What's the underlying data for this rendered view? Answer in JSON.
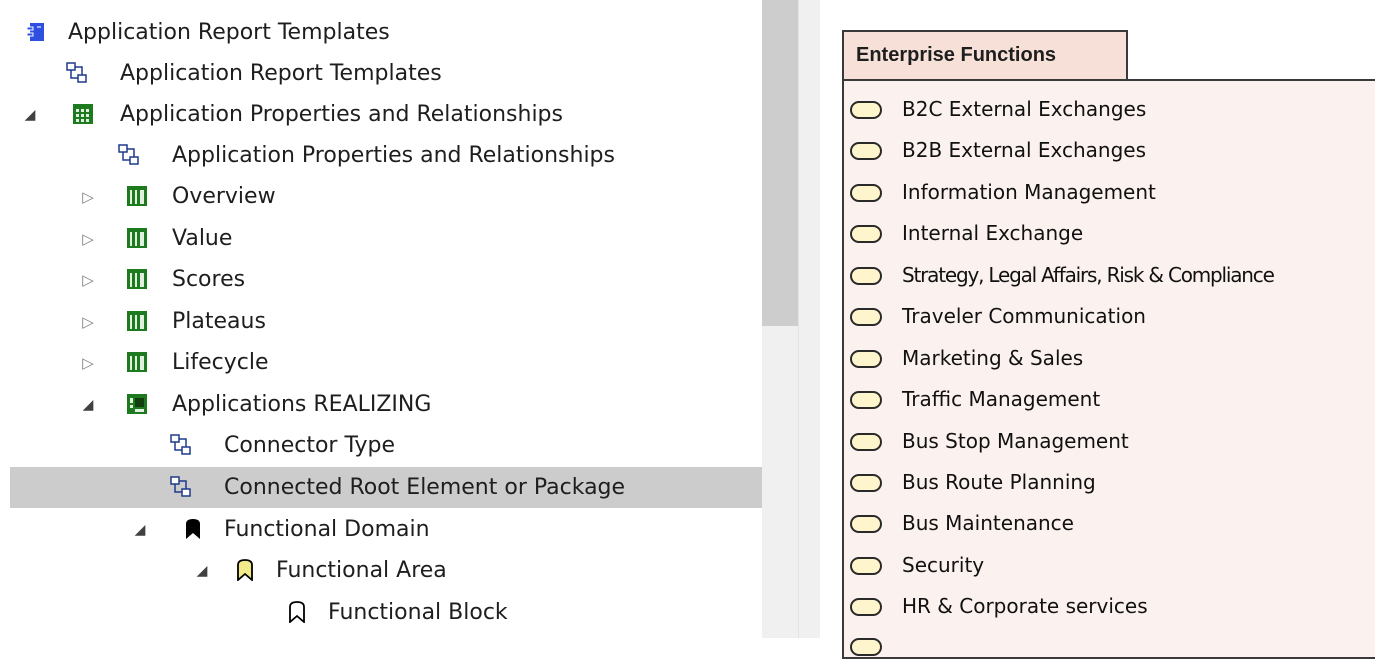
{
  "tree": {
    "items": [
      {
        "label": "Application Report Templates",
        "icon": "component-icon",
        "twisty": ""
      },
      {
        "label": "Application Report Templates",
        "icon": "diagram-icon",
        "twisty": ""
      },
      {
        "label": "Application Properties and Relationships",
        "icon": "grid-table-icon",
        "twisty": "expanded"
      },
      {
        "label": "Application Properties and Relationships",
        "icon": "diagram-icon",
        "twisty": ""
      },
      {
        "label": "Overview",
        "icon": "columns-table-icon",
        "twisty": "collapsed"
      },
      {
        "label": "Value",
        "icon": "columns-table-icon",
        "twisty": "collapsed"
      },
      {
        "label": "Scores",
        "icon": "columns-table-icon",
        "twisty": "collapsed"
      },
      {
        "label": "Plateaus",
        "icon": "columns-table-icon",
        "twisty": "collapsed"
      },
      {
        "label": "Lifecycle",
        "icon": "columns-table-icon",
        "twisty": "collapsed"
      },
      {
        "label": "Applications REALIZING",
        "icon": "matrix-table-icon",
        "twisty": "expanded"
      },
      {
        "label": "Connector Type",
        "icon": "diagram-icon",
        "twisty": ""
      },
      {
        "label": "Connected Root Element or Package",
        "icon": "diagram-icon",
        "twisty": "",
        "selected": true
      },
      {
        "label": "Functional Domain",
        "icon": "bookmark-black-icon",
        "twisty": "expanded"
      },
      {
        "label": "Functional Area",
        "icon": "bookmark-yellow-icon",
        "twisty": "expanded"
      },
      {
        "label": "Functional Block",
        "icon": "bookmark-outline-icon",
        "twisty": ""
      }
    ]
  },
  "diagram": {
    "package_title": "Enterprise Functions",
    "functions": [
      "B2C External Exchanges",
      "B2B External Exchanges",
      "Information Management",
      "Internal Exchange",
      "Strategy, Legal Affairs, Risk & Compliance",
      "Traveler Communication",
      "Marketing & Sales",
      "Traffic Management",
      "Bus Stop Management",
      "Bus Route Planning",
      "Bus Maintenance",
      "Security",
      "HR & Corporate services"
    ]
  },
  "colors": {
    "selection": "#cccccc",
    "package_tab": "#f6e0d8",
    "package_body": "#fbf1ee",
    "function_fill": "#fff5cc",
    "table_icon_green": "#1e7a1e",
    "bookmark_yellow": "#f2ea8a"
  }
}
